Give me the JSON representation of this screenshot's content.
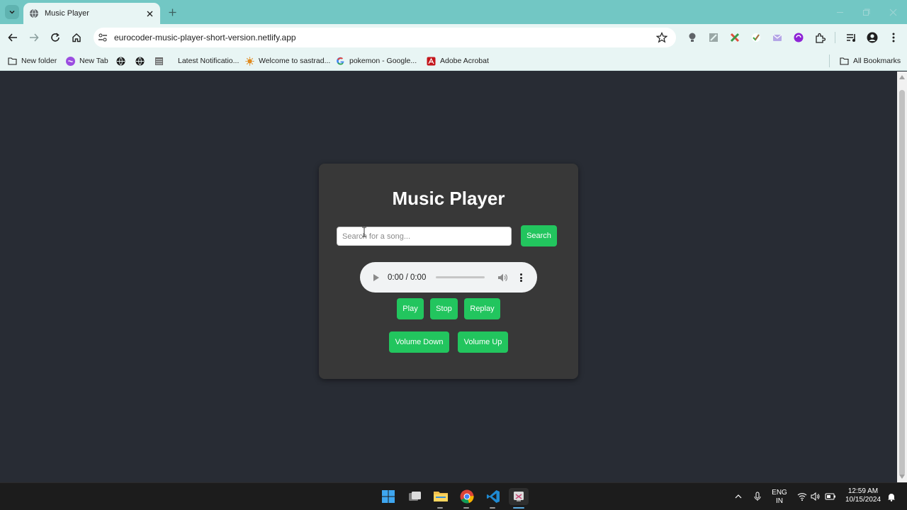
{
  "browser": {
    "tab_title": "Music Player",
    "url": "eurocoder-music-player-short-version.netlify.app",
    "bookmarks": [
      {
        "label": "New folder",
        "icon": "folder-icon"
      },
      {
        "label": "New Tab",
        "icon": "newtab-favicon"
      },
      {
        "label": "",
        "icon": "globe-icon"
      },
      {
        "label": "",
        "icon": "globe-icon"
      },
      {
        "label": "",
        "icon": "bookmark-favicon"
      },
      {
        "label": "Latest Notificatio...",
        "icon": "none"
      },
      {
        "label": "Welcome to sastrad...",
        "icon": "sun-favicon"
      },
      {
        "label": "pokemon - Google...",
        "icon": "google-icon"
      },
      {
        "label": "Adobe Acrobat",
        "icon": "acrobat-icon"
      }
    ],
    "all_bookmarks": "All Bookmarks"
  },
  "app": {
    "title": "Music Player",
    "search": {
      "placeholder": "Search for a song...",
      "value": "",
      "button": "Search"
    },
    "audio": {
      "time": "0:00 / 0:00",
      "progress": 0
    },
    "controls": {
      "play": "Play",
      "stop": "Stop",
      "replay": "Replay"
    },
    "volume": {
      "down": "Volume Down",
      "up": "Volume Up"
    }
  },
  "colors": {
    "page_bg": "#282c34",
    "card_bg": "#383838",
    "accent": "#22c55e",
    "chrome": "#72c7c4"
  },
  "taskbar": {
    "lang": "ENG",
    "region": "IN",
    "time": "12:59 AM",
    "date": "10/15/2024"
  }
}
